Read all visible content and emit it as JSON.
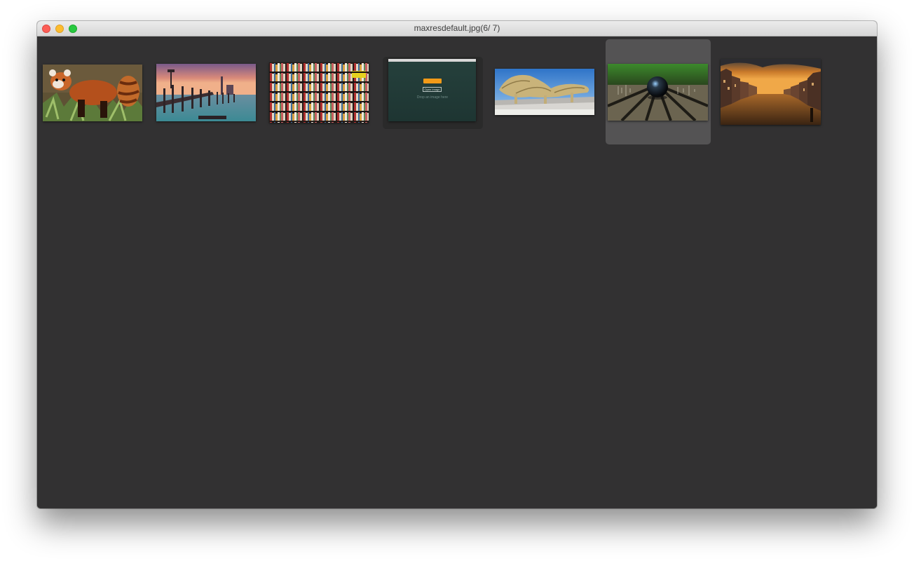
{
  "window": {
    "title": "maxresdefault.jpg(6/ 7)"
  },
  "thumbnails": [
    {
      "subject": "red panda on grass",
      "selected": false
    },
    {
      "subject": "venice pier at sunset",
      "selected": false
    },
    {
      "subject": "bookshelf wall",
      "selected": false
    },
    {
      "subject": "app window screenshot",
      "selected": false,
      "screenshot": {
        "button_label": "Open Image",
        "hint": "Drop an image here"
      }
    },
    {
      "subject": "modern canopy architecture",
      "selected": false
    },
    {
      "subject": "glass sphere on wooden planks",
      "selected": true
    },
    {
      "subject": "canal city at sunset",
      "selected": false
    }
  ]
}
